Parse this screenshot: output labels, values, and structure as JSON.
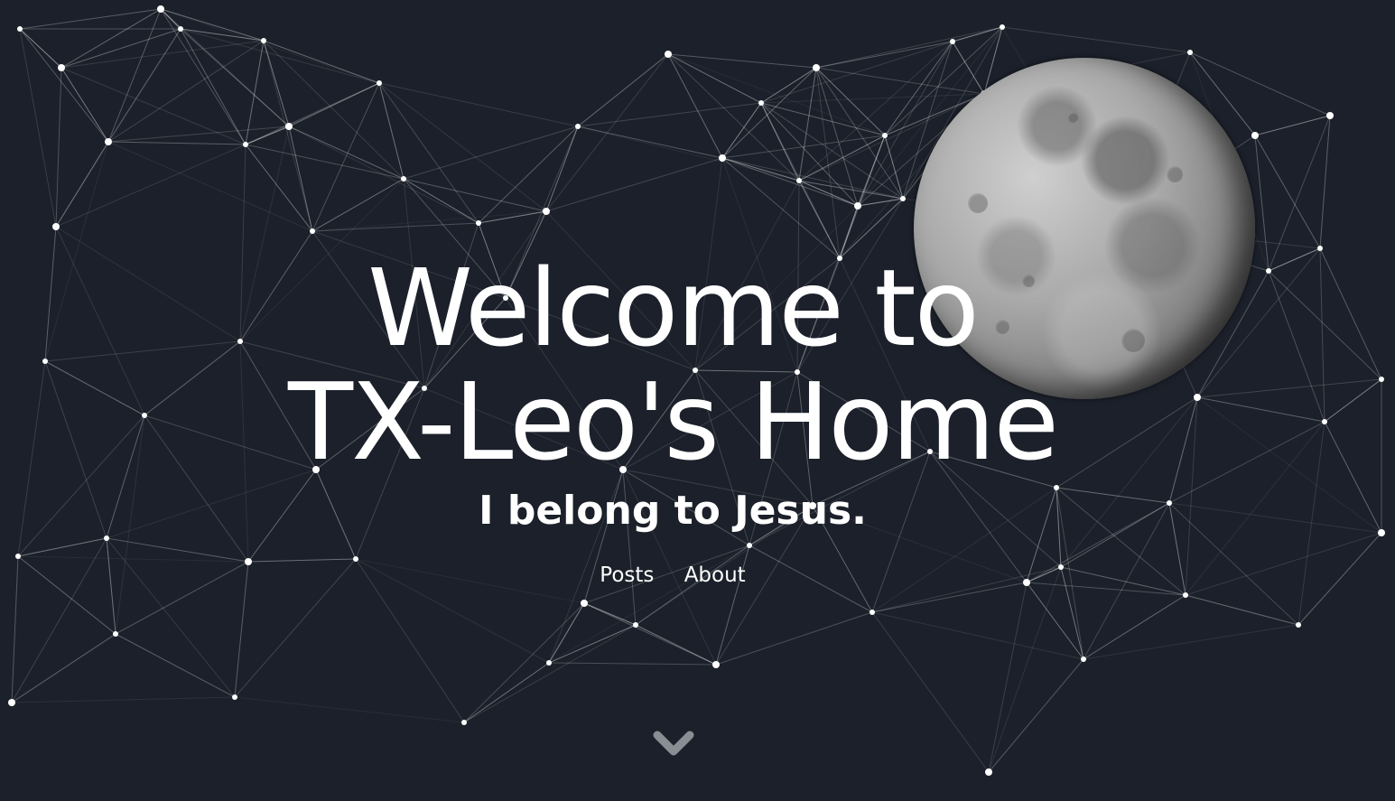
{
  "hero": {
    "title_line1": "Welcome to",
    "title_line2": "TX-Leo's Home",
    "subtitle": "I belong to Jesus.",
    "nav": [
      {
        "label": "Posts"
      },
      {
        "label": "About"
      }
    ],
    "scroll_icon": "chevron-down-icon",
    "background_image": "moon"
  },
  "colors": {
    "background": "#1b202a",
    "text": "#ffffff",
    "network_lines": "#ffffff",
    "scroll_icon": "#8a8d93"
  }
}
